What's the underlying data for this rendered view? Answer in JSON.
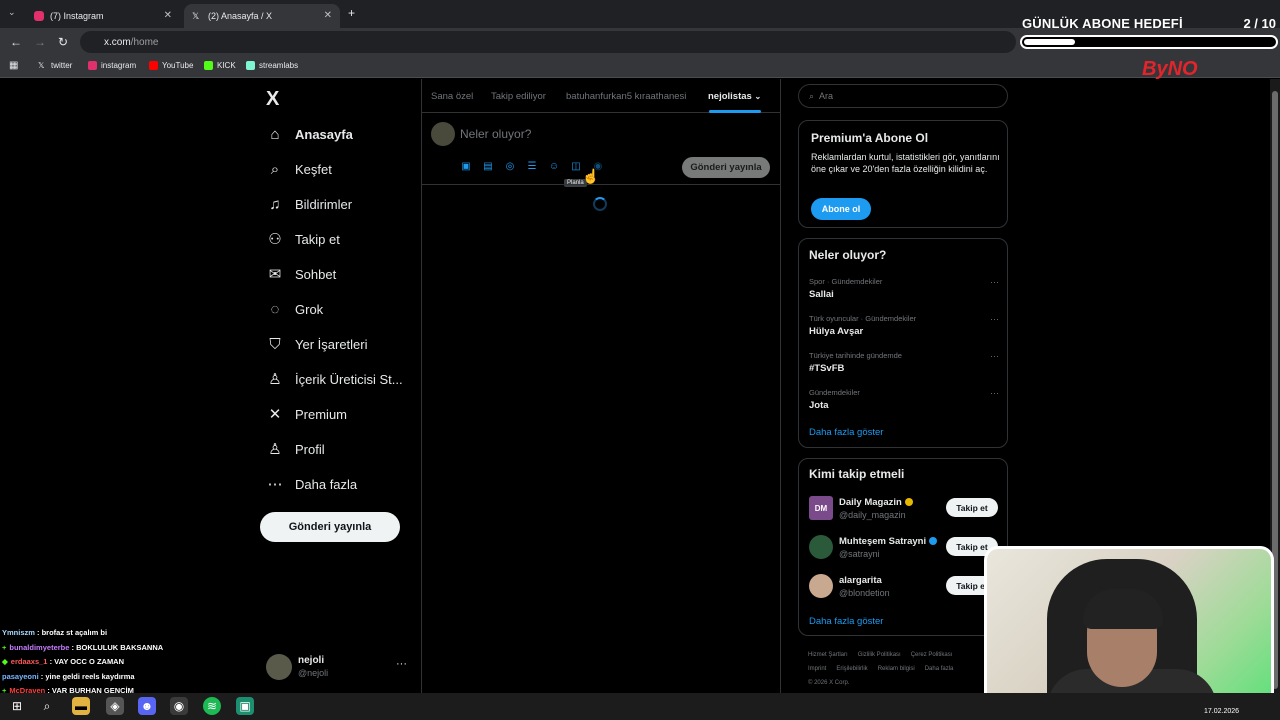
{
  "browser": {
    "tabs": [
      {
        "label": "(7) Instagram",
        "active": false
      },
      {
        "label": "(2) Anasayfa / X",
        "active": true
      }
    ],
    "new_tab": "+",
    "url_host": "x.com",
    "url_path": "/home",
    "bookmarks": [
      "twitter",
      "instagram",
      "YouTube",
      "KICK",
      "streamlabs"
    ]
  },
  "overlay": {
    "goal_title": "GÜNLÜK ABONE HEDEFİ",
    "goal_count": "2 / 10",
    "goal_progress": 0.2,
    "logo_text": "ByNO"
  },
  "sidebar": {
    "logo": "X",
    "items": [
      {
        "label": "Anasayfa",
        "icon": "home-icon",
        "glyph": "⌂"
      },
      {
        "label": "Keşfet",
        "icon": "search-icon",
        "glyph": "⌕"
      },
      {
        "label": "Bildirimler",
        "icon": "bell-icon",
        "glyph": "♫"
      },
      {
        "label": "Takip et",
        "icon": "follow-icon",
        "glyph": "⚇"
      },
      {
        "label": "Sohbet",
        "icon": "mail-icon",
        "glyph": "✉"
      },
      {
        "label": "Grok",
        "icon": "grok-icon",
        "glyph": "◌"
      },
      {
        "label": "Yer İşaretleri",
        "icon": "bookmark-icon",
        "glyph": "⛉"
      },
      {
        "label": "İçerik Üreticisi St...",
        "icon": "creator-icon",
        "glyph": "♙"
      },
      {
        "label": "Premium",
        "icon": "premium-icon",
        "glyph": "✕"
      },
      {
        "label": "Profil",
        "icon": "profile-icon",
        "glyph": "♙"
      },
      {
        "label": "Daha fazla",
        "icon": "more-icon",
        "glyph": "⋯"
      }
    ],
    "post_button": "Gönderi yayınla",
    "user": {
      "name": "nejoli",
      "handle": "@nejoli",
      "more": "···"
    }
  },
  "feed": {
    "tabs": [
      "Sana özel",
      "Takip ediliyor",
      "batuhanfurkan5 kıraathanesi",
      "nejolistas"
    ],
    "composer_placeholder": "Neler oluyor?",
    "composer_post": "Gönderi yayınla",
    "tooltip": "Planla",
    "composer_icons": [
      "image-icon",
      "gif-icon",
      "grok-icon",
      "poll-icon",
      "emoji-icon",
      "schedule-icon",
      "location-icon"
    ]
  },
  "right": {
    "search_placeholder": "Ara",
    "premium": {
      "title": "Premium'a Abone Ol",
      "text": "Reklamlardan kurtul, istatistikleri gör, yanıtlarını öne çıkar ve 20'den fazla özelliğin kilidini aç.",
      "button": "Abone ol"
    },
    "trends_title": "Neler oluyor?",
    "trends": [
      {
        "meta": "Spor · Gündemdekiler",
        "name": "Sallai"
      },
      {
        "meta": "Türk oyuncular · Gündemdekiler",
        "name": "Hülya Avşar"
      },
      {
        "meta": "Türkiye tarihinde gündemde",
        "name": "#TSvFB"
      },
      {
        "meta": "Gündemdekiler",
        "name": "Jota"
      }
    ],
    "trends_more": "Daha fazla göster",
    "who_title": "Kimi takip etmeli",
    "who": [
      {
        "name": "Daily Magazin",
        "handle": "@daily_magazin",
        "button": "Takip et",
        "verified": "#e6b800",
        "avatar_color": "#7a4a8a",
        "avatar_text": "DM"
      },
      {
        "name": "Muhteşem Satrayni",
        "handle": "@satrayni",
        "button": "Takip et",
        "verified": "#1d9bf0",
        "avatar_color": "#2a5a3a",
        "avatar_text": ""
      },
      {
        "name": "alargarita",
        "handle": "@blondetion",
        "button": "Takip et",
        "verified": "",
        "avatar_color": "#c9a890",
        "avatar_text": ""
      }
    ],
    "who_more": "Daha fazla göster",
    "footer": [
      "Hizmet Şartları",
      "Gizlilik Politikası",
      "Çerez Politikası",
      "Imprint",
      "Erişilebilirlik",
      "Reklam bilgisi",
      "Daha fazla",
      "© 2026 X Corp."
    ]
  },
  "chat": [
    {
      "user": "Ymniszm",
      "color": "#a8d8ff",
      "msg": " : brofaz st açalım bi",
      "badge": ""
    },
    {
      "user": "bunaldimyeterbe",
      "color": "#c77dff",
      "msg": " : BOKLULUK BAKSANNA",
      "badge": "+"
    },
    {
      "user": "erdaaxs_1",
      "color": "#ff5a5a",
      "msg": " : VAY OCC O ZAMAN",
      "badge": "◆"
    },
    {
      "user": "pasayeoni",
      "color": "#7ab8ff",
      "msg": " : yine geldi reels kaydırma",
      "badge": ""
    },
    {
      "user": "McDraven",
      "color": "#ff4040",
      "msg": " : VAR BURHAN GENCİM",
      "badge": "+"
    }
  ],
  "taskbar": {
    "date": "17.02.2026"
  }
}
